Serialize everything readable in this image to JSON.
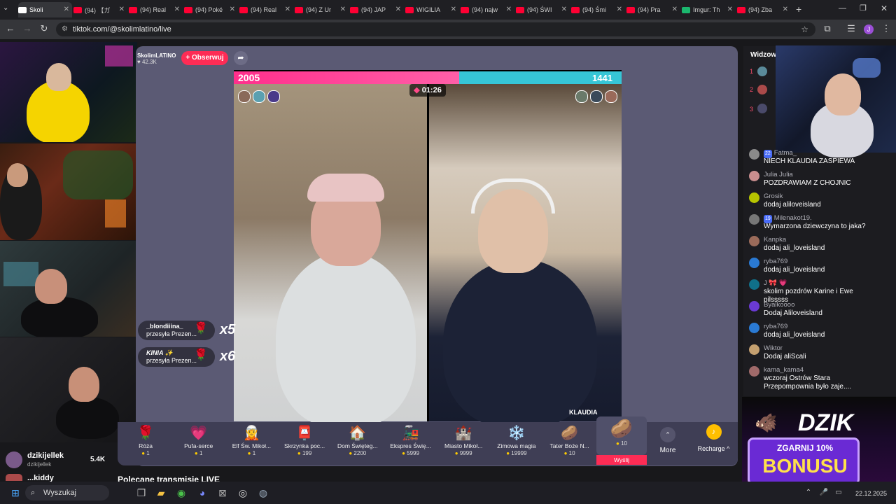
{
  "browser": {
    "tabs": [
      {
        "label": "Skoli",
        "active": true,
        "color": "#ffffff"
      },
      {
        "label": "(94) 【ガ",
        "color": "#ff0033"
      },
      {
        "label": "(94) Real",
        "color": "#ff0033"
      },
      {
        "label": "(94) Poké",
        "color": "#ff0033"
      },
      {
        "label": "(94) Real",
        "color": "#ff0033"
      },
      {
        "label": "(94) Z Ur",
        "color": "#ff0033"
      },
      {
        "label": "(94) JAP",
        "color": "#ff0033"
      },
      {
        "label": "WIGILIA",
        "color": "#ff0033"
      },
      {
        "label": "(94) najw",
        "color": "#ff0033"
      },
      {
        "label": "(94) ŚWI",
        "color": "#ff0033"
      },
      {
        "label": "(94) Śmi",
        "color": "#ff0033"
      },
      {
        "label": "(94) Pra",
        "color": "#ff0033"
      },
      {
        "label": "Imgur: Th",
        "color": "#1bb76e"
      },
      {
        "label": "(94) Zba",
        "color": "#ff0033"
      }
    ],
    "url": "tiktok.com/@skolimlatino/live",
    "profile_initial": "J"
  },
  "live": {
    "host_name": "SkolimLATINO",
    "host_likes": "42.3K",
    "follow_label": "+ Obserwuj",
    "score_left": "2005",
    "score_right": "1441",
    "score_left_fraction": 0.582,
    "timer": "01:26",
    "right_name": "KLAUDIA",
    "gift_notes": [
      {
        "user": "_blondiiina_",
        "action": "przesyła Prezen...",
        "multiplier": "x5"
      },
      {
        "user": "KINIA ✨",
        "action": "przesyła Prezen...",
        "multiplier": "x6"
      }
    ],
    "gifts": [
      {
        "name": "Róża",
        "price": "1",
        "icon": "🌹"
      },
      {
        "name": "Pufa-serce",
        "price": "1",
        "icon": "💗"
      },
      {
        "name": "Elf Św. Mikoł...",
        "price": "1",
        "icon": "🧝"
      },
      {
        "name": "Skrzynka poc...",
        "price": "199",
        "icon": "📮"
      },
      {
        "name": "Dom Święteg...",
        "price": "2200",
        "icon": "🏠"
      },
      {
        "name": "Ekspres Świę...",
        "price": "5999",
        "icon": "🚂"
      },
      {
        "name": "Miasto Mikoł...",
        "price": "9999",
        "icon": "🏰"
      },
      {
        "name": "Zimowa magia",
        "price": "19999",
        "icon": "❄️"
      },
      {
        "name": "Tater Boże N...",
        "price": "10",
        "icon": "🥔"
      }
    ],
    "selected_gift_price": "10",
    "send_label": "Wyślij",
    "more_label": "More",
    "recharge_label": "Recharge ^",
    "recommended_label": "Polecane transmisje LIVE"
  },
  "viewers_panel": {
    "top_user": "dzikijellek",
    "top_user_sub": "dzikijellek",
    "top_user_count": "5.4K",
    "second_user": "...kiddy"
  },
  "chat": {
    "header": "Widzow",
    "ranks": [
      "1",
      "2",
      "3"
    ],
    "messages": [
      {
        "user": "Fatma_",
        "badge": "22",
        "text": "NIECH KLAUDIA ZASPIEWA",
        "color": "#8a8a8a"
      },
      {
        "user": "Julia Julia",
        "badge": "",
        "text": "POZDRAWIAM Z CHOJNIC",
        "color": "#c98e8e"
      },
      {
        "user": "Grosik",
        "badge": "",
        "text": "dodaj aliloveisland",
        "color": "#b6c400"
      },
      {
        "user": "Milenakot19.",
        "badge": "19",
        "text": "Wymarzona dziewczyna to jaka?",
        "color": "#777777"
      },
      {
        "user": "Kanpka",
        "badge": "",
        "text": "dodaj ali_loveisland",
        "color": "#9b6b5a"
      },
      {
        "user": "ryba769",
        "badge": "",
        "text": "dodaj ali_loveisland",
        "color": "#2a7ad4"
      },
      {
        "user": "J 🎀 💗",
        "badge": "",
        "text": "skolim pozdrów Karine i Ewe pilsssss",
        "color": "#10708a"
      },
      {
        "user": "Byalkoooo",
        "badge": "",
        "text": "Dodaj Aliloveisland",
        "color": "#6a3ad4"
      },
      {
        "user": "ryba769",
        "badge": "",
        "text": "dodaj ali_loveisland",
        "color": "#2a7ad4"
      },
      {
        "user": "Wiktor",
        "badge": "",
        "text": "Dodaj aliScali",
        "color": "#c4a070"
      },
      {
        "user": "kama_kama4",
        "badge": "",
        "text": "wczoraj Ostrów Stara Przepompownia było zaje....",
        "color": "#a06a6a"
      }
    ]
  },
  "ad": {
    "brand": "DZIK",
    "line1": "ZGARNIJ 10%",
    "line2": "BONUSU"
  },
  "taskbar": {
    "search_placeholder": "Wyszukaj",
    "date": "22.12.2025"
  }
}
